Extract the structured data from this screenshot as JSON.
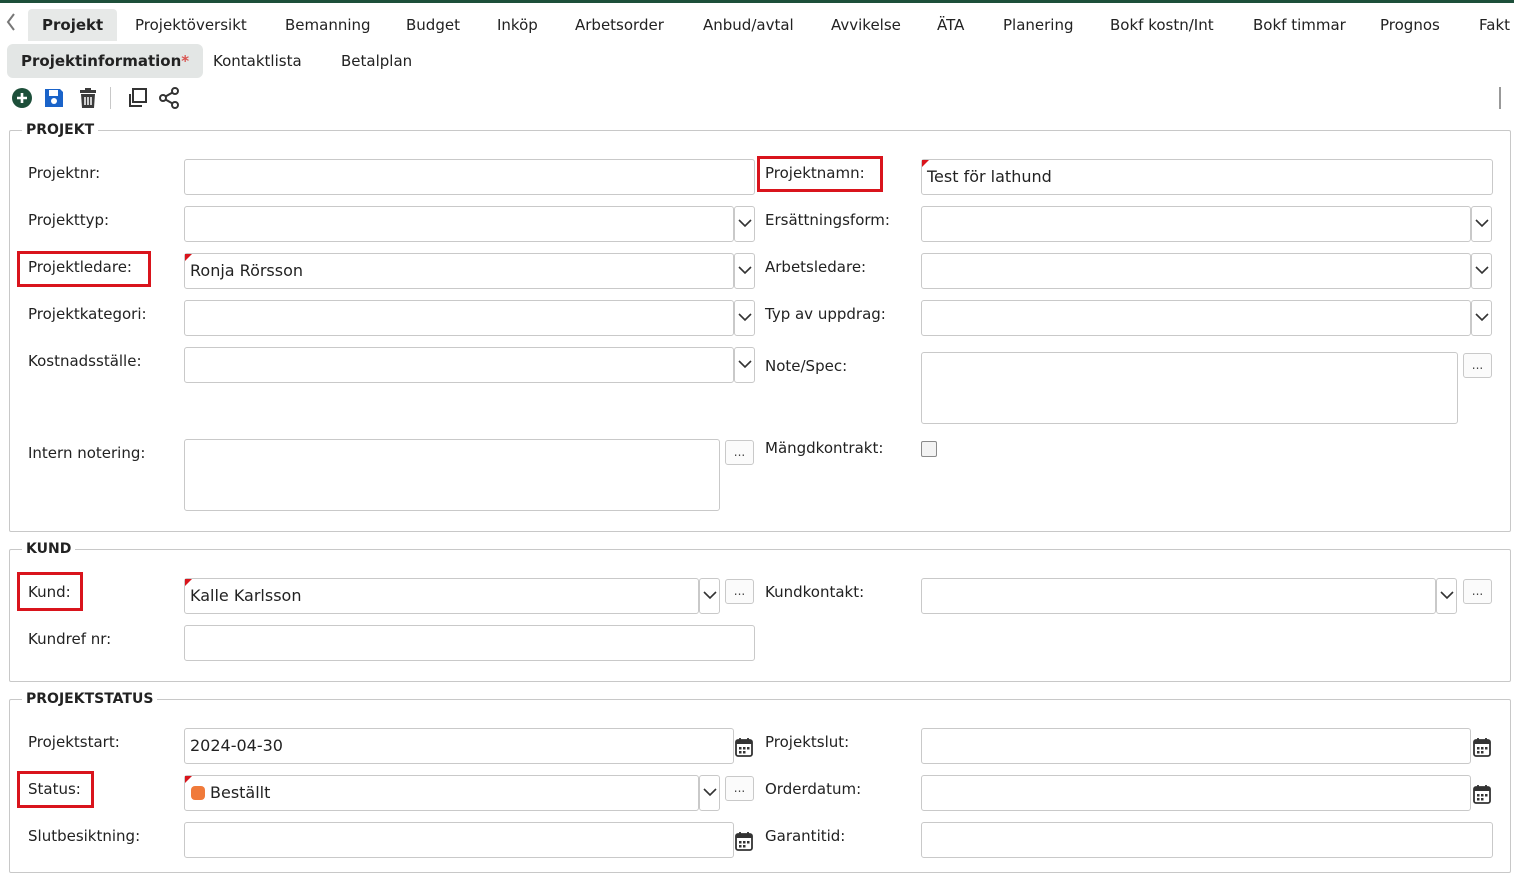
{
  "tabs": [
    "Projekt",
    "Projektöversikt",
    "Bemanning",
    "Budget",
    "Inköp",
    "Arbetsorder",
    "Anbud/avtal",
    "Avvikelse",
    "ÄTA",
    "Planering",
    "Bokf kostn/Int",
    "Bokf timmar",
    "Prognos",
    "Fakt"
  ],
  "subtabs": {
    "projektinformation": "Projektinformation",
    "required_mark": "*",
    "kontaktlista": "Kontaktlista",
    "betalplan": "Betalplan"
  },
  "toolbar": {
    "icons": [
      "add-icon",
      "save-icon",
      "delete-icon",
      "copy-icon",
      "share-icon"
    ]
  },
  "colors": {
    "accent": "#1d4f3a",
    "highlight": "#d9141c",
    "status_bestallt": "#f07a3a",
    "save_blue": "#1a63c9"
  },
  "sections": {
    "projekt": {
      "legend": "PROJEKT",
      "projektnr_label": "Projektnr:",
      "projektnr_value": "",
      "projektnamn_label": "Projektnamn:",
      "projektnamn_value": "Test för lathund",
      "projekttyp_label": "Projekttyp:",
      "projekttyp_value": "",
      "ersattningsform_label": "Ersättningsform:",
      "ersattningsform_value": "",
      "projektledare_label": "Projektledare:",
      "projektledare_value": "Ronja Rörsson",
      "arbetsledare_label": "Arbetsledare:",
      "arbetsledare_value": "",
      "projektkategori_label": "Projektkategori:",
      "projektkategori_value": "",
      "typ_av_uppdrag_label": "Typ av uppdrag:",
      "typ_av_uppdrag_value": "",
      "kostnadsstalle_label": "Kostnadsställe:",
      "kostnadsstalle_value": "",
      "note_spec_label": "Note/Spec:",
      "intern_notering_label": "Intern notering:",
      "mangdkontrakt_label": "Mängdkontrakt:"
    },
    "kund": {
      "legend": "KUND",
      "kund_label": "Kund:",
      "kund_value": "Kalle Karlsson",
      "kundkontakt_label": "Kundkontakt:",
      "kundkontakt_value": "",
      "kundref_label": "Kundref nr:",
      "kundref_value": ""
    },
    "projektstatus": {
      "legend": "PROJEKTSTATUS",
      "projektstart_label": "Projektstart:",
      "projektstart_value": "2024-04-30",
      "projektslut_label": "Projektslut:",
      "projektslut_value": "",
      "status_label": "Status:",
      "status_value": "Beställt",
      "orderdatum_label": "Orderdatum:",
      "orderdatum_value": "",
      "slutbesiktning_label": "Slutbesiktning:",
      "slutbesiktning_value": "",
      "garantitid_label": "Garantitid:",
      "garantitid_value": ""
    }
  },
  "common": {
    "more_button": "..."
  }
}
